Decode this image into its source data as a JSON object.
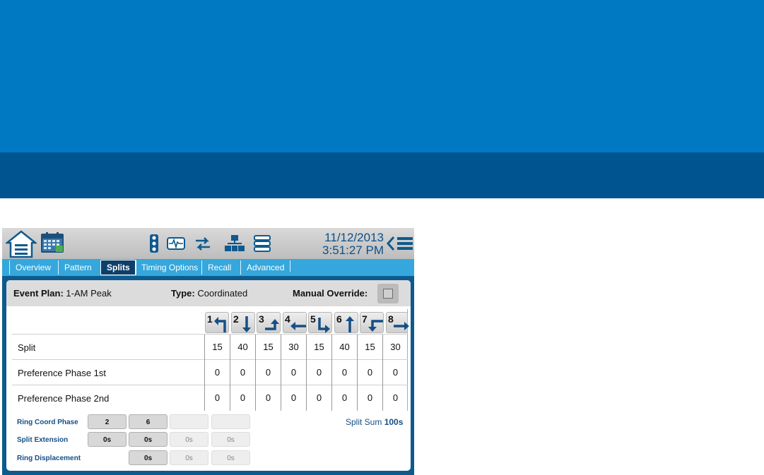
{
  "colors": {
    "banner_top": "#0079c2",
    "banner_bottom": "#005590",
    "tab_bar": "#35a7dc",
    "active_tab": "#0d3f6a",
    "accent_text": "#154f86"
  },
  "toolbar": {
    "date": "11/12/2013",
    "time": "3:51:27 PM",
    "icons": [
      "home-menu-icon",
      "calendar-icon",
      "traffic-signal-icon",
      "monitor-wave-icon",
      "transfer-arrows-icon",
      "network-icon",
      "database-icon",
      "back-icon",
      "menu-icon"
    ]
  },
  "tabs": [
    {
      "label": "Overview",
      "active": false
    },
    {
      "label": "Pattern",
      "active": false
    },
    {
      "label": "Splits",
      "active": true
    },
    {
      "label": "Timing Options",
      "active": false
    },
    {
      "label": "Recall",
      "active": false
    },
    {
      "label": "Advanced",
      "active": false
    }
  ],
  "plan": {
    "event_plan_label": "Event Plan:",
    "event_plan_value": "1-AM Peak",
    "type_label": "Type:",
    "type_value": "Coordinated",
    "manual_override_label": "Manual Override:",
    "manual_override_checked": false
  },
  "phases": [
    {
      "number": "1",
      "movement": "left-turn-icon"
    },
    {
      "number": "2",
      "movement": "through-down-icon"
    },
    {
      "number": "3",
      "movement": "left-turn-icon"
    },
    {
      "number": "4",
      "movement": "through-left-icon"
    },
    {
      "number": "5",
      "movement": "left-turn-icon"
    },
    {
      "number": "6",
      "movement": "through-up-icon"
    },
    {
      "number": "7",
      "movement": "left-turn-icon"
    },
    {
      "number": "8",
      "movement": "through-right-icon"
    }
  ],
  "rows": [
    {
      "label": "Split",
      "values": [
        "15",
        "40",
        "15",
        "30",
        "15",
        "40",
        "15",
        "30"
      ]
    },
    {
      "label": "Preference Phase 1st",
      "values": [
        "0",
        "0",
        "0",
        "0",
        "0",
        "0",
        "0",
        "0"
      ]
    },
    {
      "label": "Preference Phase 2nd",
      "values": [
        "0",
        "0",
        "0",
        "0",
        "0",
        "0",
        "0",
        "0"
      ]
    }
  ],
  "ring_coord_phase": {
    "label": "Ring Coord Phase",
    "values": [
      "2",
      "6",
      "",
      ""
    ]
  },
  "split_extension": {
    "label": "Split Extension",
    "values": [
      "0s",
      "0s",
      "0s",
      "0s"
    ]
  },
  "ring_displacement": {
    "label": "Ring Displacement",
    "values": [
      "0s",
      "0s",
      "0s"
    ]
  },
  "split_sum": {
    "label": "Split Sum",
    "value": "100s"
  }
}
